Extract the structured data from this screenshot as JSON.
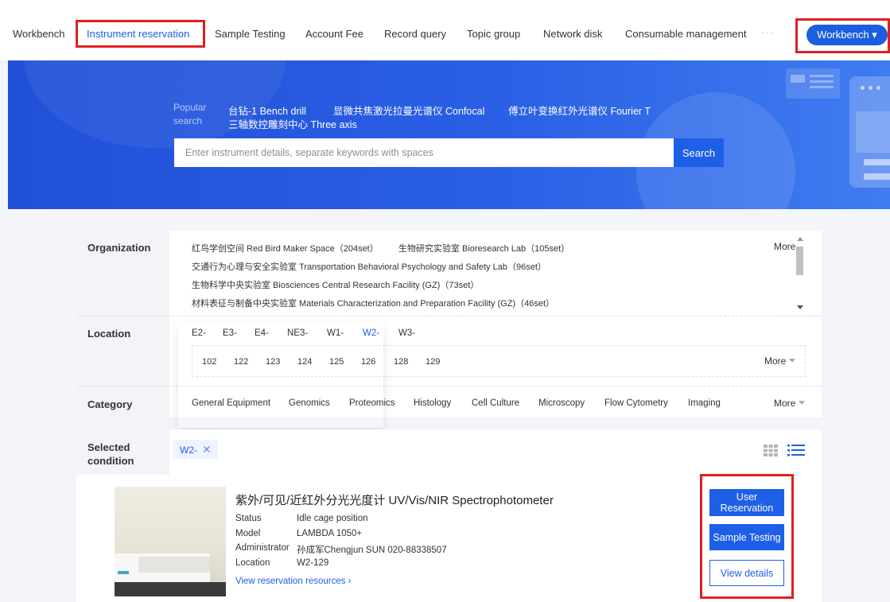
{
  "nav": {
    "items": [
      "Workbench",
      "Instrument reservation",
      "Sample Testing",
      "Account Fee",
      "Record query",
      "Topic group",
      "Network disk",
      "Consumable management"
    ],
    "more": "···",
    "workbench_button": "Workbench ▾"
  },
  "hero": {
    "popular_label": "Popular search",
    "popular": [
      "台钻-1 Bench drill",
      "显微共焦激光拉曼光谱仪 Confocal",
      "傅立叶变换红外光谱仪 Fourier T",
      "三轴数控雕刻中心 Three axis"
    ],
    "search_placeholder": "Enter instrument details, separate keywords with spaces",
    "search_button": "Search"
  },
  "filters": {
    "organization": {
      "label": "Organization",
      "items": [
        "红鸟学创空间 Red Bird Maker Space（204set）",
        "生物研究实验室 Bioresearch Lab（105set）",
        "交通行为心理与安全实验室 Transportation Behavioral Psychology and Safety Lab（96set）",
        "生物科学中央实验室 Biosciences Central Research Facility (GZ)（73set）",
        "材料表征与制备中央实验室 Materials Characterization and Preparation Facility (GZ)（46set）"
      ],
      "more": "More"
    },
    "location": {
      "label": "Location",
      "items": [
        "E2-",
        "E3-",
        "E4-",
        "NE3-",
        "W1-",
        "W2-",
        "W3-"
      ],
      "selected": "W2-",
      "rooms": [
        "102",
        "122",
        "123",
        "124",
        "125",
        "126",
        "128",
        "129"
      ],
      "more": "More"
    },
    "category": {
      "label": "Category",
      "items": [
        "General Equipment",
        "Genomics",
        "Proteomics",
        "Histology",
        "Cell Culture",
        "Microscopy",
        "Flow Cytometry",
        "Imaging"
      ],
      "more": "More"
    }
  },
  "results": {
    "selected_label": "Selected condition",
    "tag": "W2-",
    "tag_remove": "✕",
    "item": {
      "title": "紫外/可见/近红外分光光度计 UV/Vis/NIR Spectrophotometer",
      "status_key": "Status",
      "status": "Idle cage position",
      "model_key": "Model",
      "model": "LAMBDA 1050+",
      "admin_key": "Administrator",
      "admin": "孙成军Chengjun SUN 020-88338507",
      "location_key": "Location",
      "location": "W2-129",
      "link": "View reservation resources ›",
      "buttons": {
        "reserve": "User Reservation",
        "sample": "Sample Testing",
        "details": "View details"
      }
    }
  },
  "colors": {
    "accent": "#1e5fe8",
    "highlight_box": "#e02020",
    "hero": "#2150d8"
  },
  "icons": [
    "grid-view-icon",
    "list-view-icon",
    "scroll-up-icon",
    "scroll-down-icon",
    "close-icon"
  ]
}
